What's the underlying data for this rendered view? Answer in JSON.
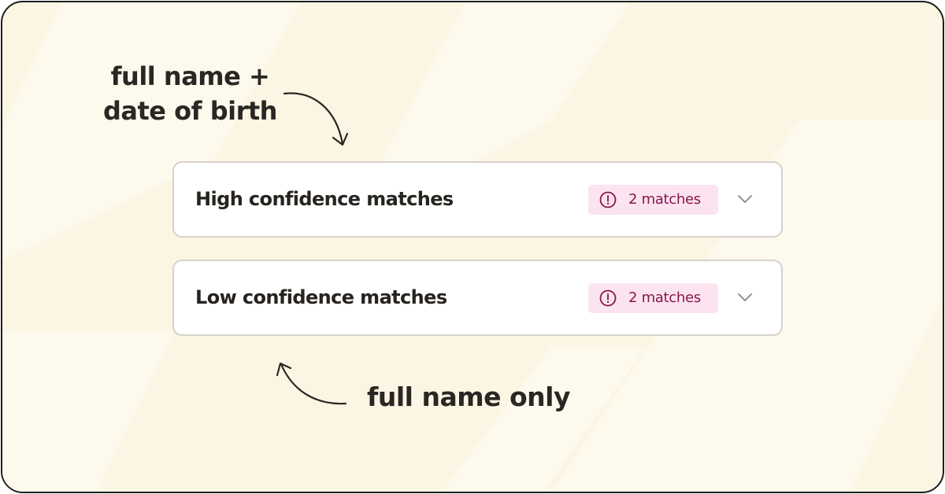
{
  "annotations": {
    "top_line_1": "full name +",
    "top_line_2": "date of birth",
    "bottom": "full name only"
  },
  "accordions": [
    {
      "title": "High confidence matches",
      "badge": {
        "icon": "alert-circle-icon",
        "label": "2 matches"
      },
      "chevron": "chevron-down-icon",
      "expanded": false
    },
    {
      "title": "Low confidence matches",
      "badge": {
        "icon": "alert-circle-icon",
        "label": "2 matches"
      },
      "chevron": "chevron-down-icon",
      "expanded": false
    }
  ],
  "colors": {
    "background": "#fbf5e3",
    "background_stripe": "#fdf9ec",
    "card": "#ffffff",
    "card_border": "#d6d2cc",
    "text": "#27231f",
    "badge_bg": "#fbe4ef",
    "badge_text": "#8a1650",
    "chevron": "#8c8782"
  }
}
